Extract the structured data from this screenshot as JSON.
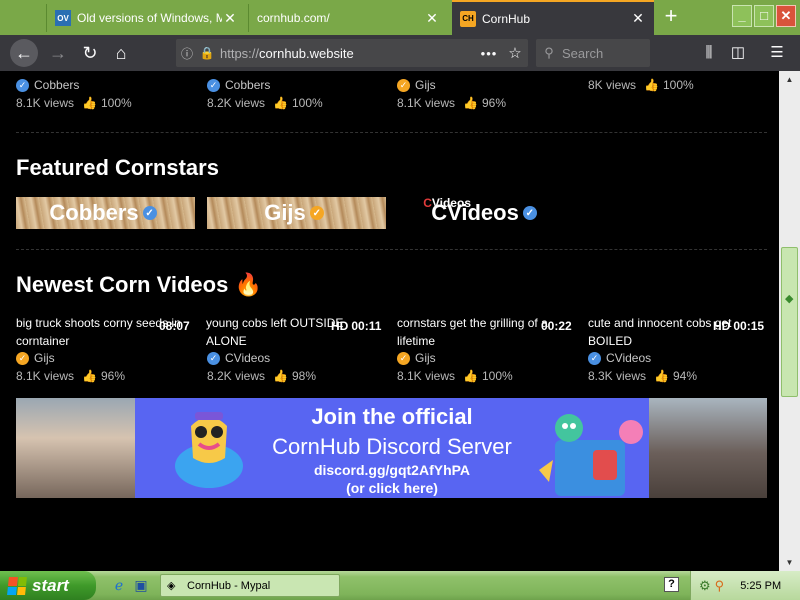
{
  "browser": {
    "tabs": [
      {
        "favicon": "OV",
        "title": "Old versions of Windows, Ma"
      },
      {
        "favicon": "",
        "title": "cornhub.com/"
      },
      {
        "favicon": "CH",
        "title": "CornHub"
      }
    ],
    "url": {
      "scheme": "https://",
      "host": "cornhub.website"
    },
    "search_placeholder": "Search"
  },
  "top_row": [
    {
      "channel": "Cobbers",
      "badge": "blue",
      "views": "8.1K views",
      "rating": "100%"
    },
    {
      "channel": "Cobbers",
      "badge": "blue",
      "views": "8.2K views",
      "rating": "100%"
    },
    {
      "channel": "Gijs",
      "badge": "orange",
      "views": "8.1K views",
      "rating": "96%"
    },
    {
      "channel": "",
      "badge": "",
      "views": "8K views",
      "rating": "100%"
    }
  ],
  "featured": {
    "title": "Featured Cornstars",
    "stars": [
      {
        "name": "Cobbers",
        "badge": "blue"
      },
      {
        "name": "Gijs",
        "badge": "orange"
      },
      {
        "name": "CVideos",
        "badge": "blue",
        "logo_c": "C",
        "logo_text": "Videos"
      }
    ]
  },
  "newest": {
    "title": "Newest Corn Videos",
    "emoji": "🔥",
    "videos": [
      {
        "title": "big truck shoots corny seeds in corntainer",
        "hd": "",
        "duration": "08:07",
        "channel": "Gijs",
        "badge": "orange",
        "views": "8.1K views",
        "rating": "96%"
      },
      {
        "title": "young cobs left OUTSIDE ALONE",
        "hd": "HD",
        "duration": "00:11",
        "channel": "CVideos",
        "badge": "blue",
        "views": "8.2K views",
        "rating": "98%"
      },
      {
        "title": "cornstars get the grilling of a lifetime",
        "hd": "",
        "duration": "00:22",
        "channel": "Gijs",
        "badge": "orange",
        "views": "8.1K views",
        "rating": "100%"
      },
      {
        "title": "cute and innocent cobs get BOILED",
        "hd": "HD",
        "duration": "00:15",
        "channel": "CVideos",
        "badge": "blue",
        "views": "8.3K views",
        "rating": "94%"
      }
    ]
  },
  "banner": {
    "line1": "Join the official",
    "line2": "CornHub Discord Server",
    "line3": "discord.gg/gqt2AfYhPA",
    "line4": "(or click here)"
  },
  "taskbar": {
    "start_label": "start",
    "task_label": "CornHub - Mypal",
    "clock": "5:25 PM"
  },
  "colors": {
    "accent": "#f5a623",
    "verified_blue": "#4a90e2",
    "discord": "#5865f2",
    "xp_green": "#7fb45a"
  },
  "icons": [
    "back-arrow-icon",
    "forward-arrow-icon",
    "reload-icon",
    "home-icon",
    "info-icon",
    "lock-icon",
    "star-icon",
    "search-icon",
    "library-icon",
    "sidebar-icon",
    "menu-icon",
    "thumbs-up-icon",
    "fire-icon"
  ]
}
